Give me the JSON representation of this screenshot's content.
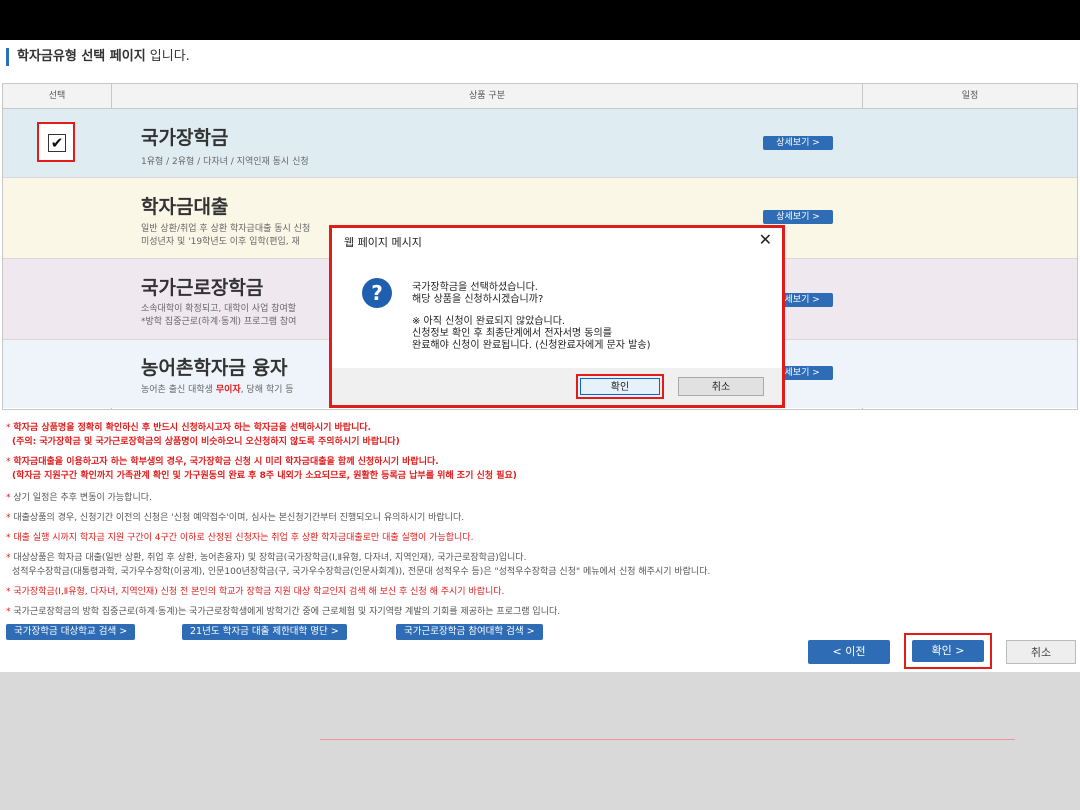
{
  "page": {
    "title_bold": "학자금유형 선택 페이지",
    "title_rest": "입니다."
  },
  "table": {
    "headers": [
      "선택",
      "상품 구분",
      "일정"
    ],
    "rows": [
      {
        "name": "국가장학금",
        "desc": "1유형 / 2유형 / 다자녀 / 지역인재 동시 신청",
        "detail": "상세보기 >",
        "bg": "#dfedf3"
      },
      {
        "name": "학자금대출",
        "desc": "일반 상환/취업 후 상환 학자금대출 동시 신청",
        "desc2": "미성년자 및 '19학년도 이후 입학(편입, 재",
        "detail": "상세보기 >",
        "bg": "#faf7e7"
      },
      {
        "name": "국가근로장학금",
        "desc": "소속대학이 확정되고, 대학이 사업 참여할",
        "desc2": "*방학 집중근로(하계·동계) 프로그램 참여",
        "detail": "상세보기 >",
        "bg": "#efe9ef"
      },
      {
        "name": "농어촌학자금 융자",
        "desc": "농어촌 출신 대학생",
        "desc_red": "무이자",
        "desc_tail": ", 당해 학기 등",
        "detail": "상세보기 >",
        "bg": "#eef4fa"
      }
    ]
  },
  "notes": [
    {
      "text": "학자금 상품명을 정확히 확인하신 후 반드시 신청하시고자 하는 학자금을 선택하시기 바랍니다.",
      "cls": "redb"
    },
    {
      "text": "(주의: 국가장학금 및 국가근로장학금의 상품명이 비슷하오니 오신청하지 않도록 주의하시기 바랍니다)",
      "cls": "redb"
    },
    {
      "text": "학자금대출을 이용하고자 하는 학부생의 경우, 국가장학금 신청 시 미리 학자금대출을 함께 신청하시기 바랍니다.",
      "cls": "redb"
    },
    {
      "text": "(학자금 지원구간 확인까지 가족관계 확인 및 가구원동의 완료 후 8주 내외가 소요되므로, 원활한 등록금 납부를 위해 조기 신청 필요)",
      "cls": "redb"
    },
    {
      "text": "상기 일정은 추후 변동이 가능합니다.",
      "cls": "gray"
    },
    {
      "text": "대출상품의 경우, 신청기간 이전의 신청은 '신청 예약접수'이며, 심사는 본신청기간부터 진행되오니 유의하시기 바랍니다.",
      "cls": "gray"
    },
    {
      "text": "대출 실행 시까지 학자금 지원 구간이 4구간 이하로 산정된 신청자는 취업 후 상환 학자금대출로만 대출 실행이 가능합니다.",
      "cls": "red"
    },
    {
      "text": "대상상품은 학자금 대출(일반 상환, 취업 후 상환, 농어촌융자) 및 장학금(국가장학금(Ⅰ,Ⅱ유형, 다자녀, 지역인재), 국가근로장학금)입니다.",
      "cls": "gray"
    },
    {
      "text": "성적우수장학금(대통령과학, 국가우수장학(이공계), 인문100년장학금(구, 국가우수장학금(인문사회계)), 전문대 성적우수 등)은 \"성적우수장학금 신청\" 메뉴에서 신청 해주시기 바랍니다.",
      "cls": "gray"
    },
    {
      "text": "국가장학금(Ⅰ,Ⅱ유형, 다자녀, 지역인재) 신청 전 본인의 학교가 장학금 지원 대상 학교인지 검색 해 보신 후 신청 해 주시기 바랍니다.",
      "cls": "red"
    },
    {
      "text": "국가근로장학금의 방학 집중근로(하계·동계)는 국가근로장학생에게 방학기간 중에 근로체험 및 자기역량 계발의 기회를 제공하는 프로그램 입니다.",
      "cls": "gray"
    }
  ],
  "links": [
    "국가장학금 대상학교 검색 >",
    "21년도 학자금 대출 제한대학 명단 >",
    "국가근로장학금 참여대학 검색 >"
  ],
  "nav": {
    "prev": "< 이전",
    "ok": "확인 >",
    "cancel": "취소"
  },
  "dialog": {
    "title": "웹 페이지 메시지",
    "close": "✕",
    "icon": "?",
    "lines": [
      "국가장학금을 선택하셨습니다.",
      "해당 상품을 신청하시겠습니까?",
      "※ 아직 신청이 완료되지 않았습니다.",
      "신청정보 확인 후 최종단계에서 전자서명 동의를",
      "완료해야 신청이 완료됩니다. (신청완료자에게 문자 발송)"
    ],
    "ok": "확인",
    "cancel": "취소"
  }
}
